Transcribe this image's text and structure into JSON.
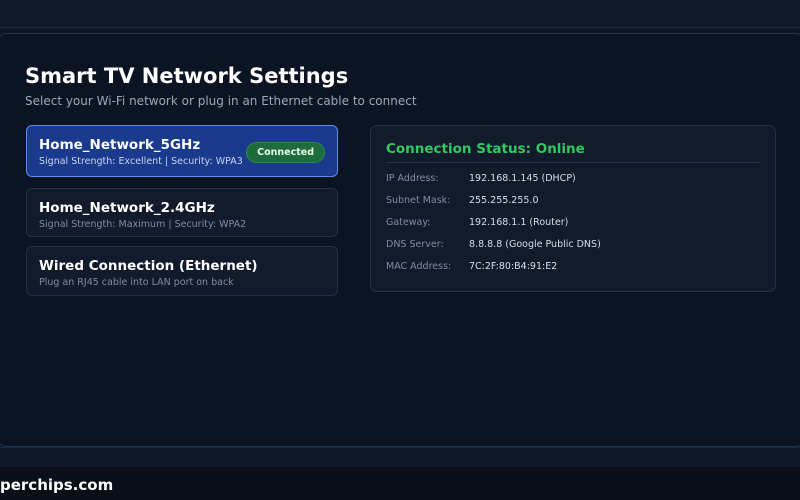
{
  "header": {
    "title": "Smart TV Network Settings",
    "subtitle": "Select your Wi-Fi network or plug in an Ethernet cable to connect"
  },
  "networks": [
    {
      "name": "Home_Network_5GHz",
      "detail": "Signal Strength: Excellent | Security: WPA3",
      "badge": "Connected",
      "selected": true
    },
    {
      "name": "Home_Network_2.4GHz",
      "detail": "Signal Strength: Maximum | Security: WPA2",
      "selected": false
    },
    {
      "name": "Wired Connection (Ethernet)",
      "detail": "Plug an RJ45 cable into LAN port on back",
      "selected": false
    }
  ],
  "status": {
    "title": "Connection Status: Online",
    "rows": [
      {
        "label": "IP Address:",
        "value": "192.168.1.145 (DHCP)"
      },
      {
        "label": "Subnet Mask:",
        "value": "255.255.255.0"
      },
      {
        "label": "Gateway:",
        "value": "192.168.1.1 (Router)"
      },
      {
        "label": "DNS Server:",
        "value": "8.8.8.8 (Google Public DNS)"
      },
      {
        "label": "MAC Address:",
        "value": "7C:2F:80:B4:91:E2"
      }
    ]
  },
  "footer": {
    "text": "perchips.com"
  },
  "colors": {
    "accent": "#1a3a8e",
    "accent_border": "#5b8cf0",
    "online_green": "#2ecc5e",
    "badge_green": "#1e6b3c"
  }
}
